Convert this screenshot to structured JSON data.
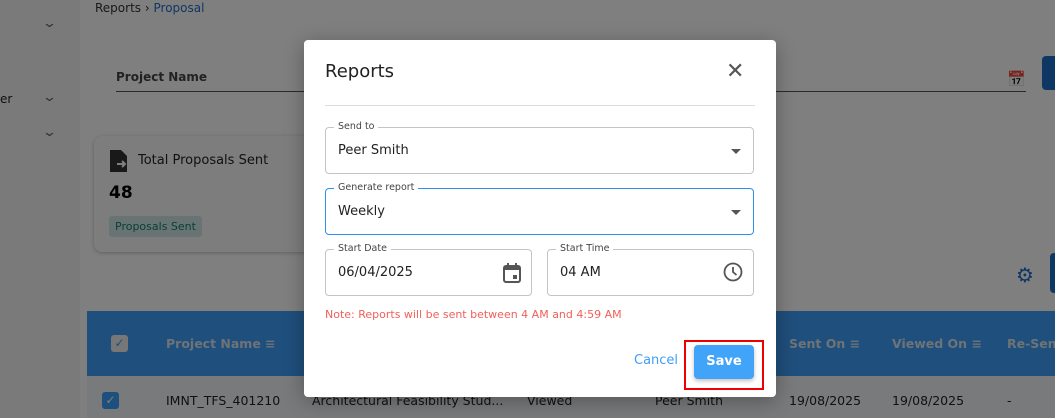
{
  "breadcrumb": {
    "parent": "Reports",
    "separator": "›",
    "current": "Proposal"
  },
  "sidebar": {
    "partial_label": "er",
    "chevron": "⌄"
  },
  "filter": {
    "project_name_label": "Project Name",
    "calendar_icon": "📅"
  },
  "summary_card": {
    "title": "Total Proposals Sent",
    "value": "48",
    "badge": "Proposals Sent"
  },
  "table": {
    "headers": [
      "Project Name",
      "Sent On",
      "Viewed On",
      "Re-Sen"
    ],
    "sort_icon": "≡",
    "rows": [
      {
        "project": "IMNT_TFS_401210",
        "name": "Architectural Feasibility Stud...",
        "status": "Viewed",
        "recipient": "Peer Smith",
        "sent_on": "19/08/2025",
        "viewed_on": "19/08/2025",
        "resent": "-"
      }
    ]
  },
  "dialog": {
    "title": "Reports",
    "close": "✕",
    "send_to": {
      "label": "Send to",
      "value": "Peer Smith"
    },
    "generate_report": {
      "label": "Generate report",
      "value": "Weekly"
    },
    "start_date": {
      "label": "Start Date",
      "value": "06/04/2025"
    },
    "start_time": {
      "label": "Start Time",
      "value": "04 AM"
    },
    "note": "Note: Reports will be sent between 4 AM and 4:59 AM",
    "cancel": "Cancel",
    "save": "Save"
  },
  "colors": {
    "accent": "#42a4f8",
    "note": "#f0605a",
    "table_header": "#3e9ef8"
  }
}
